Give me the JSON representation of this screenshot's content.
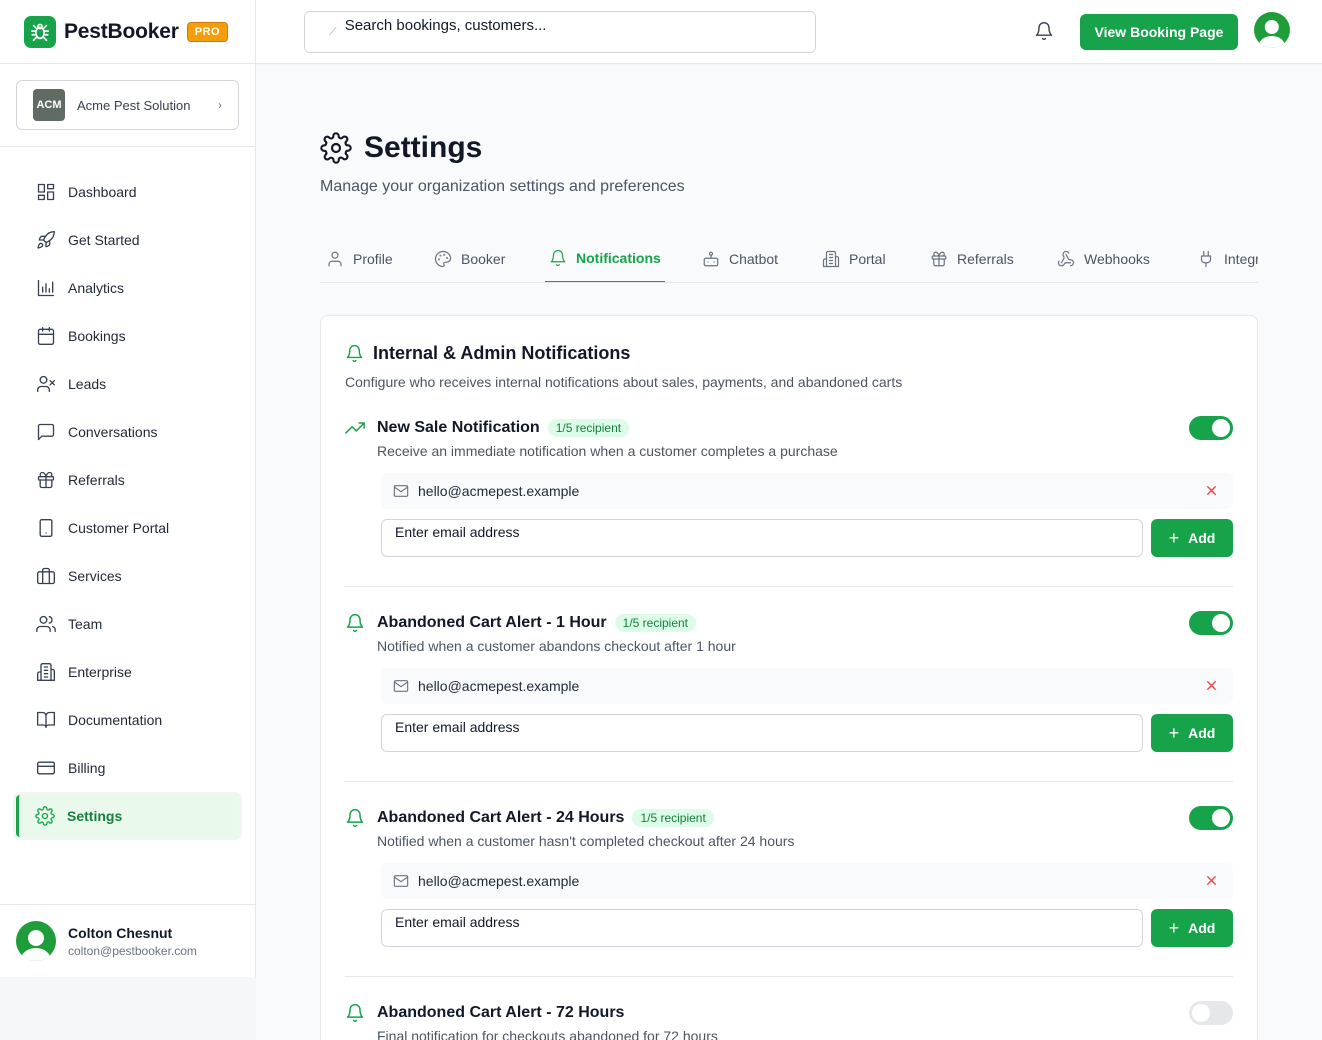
{
  "brand": {
    "name": "PestBooker",
    "badge": "PRO"
  },
  "org": {
    "name": "Acme Pest Solution",
    "logo_text": "ACM"
  },
  "sidebar": {
    "items": [
      {
        "label": "Dashboard",
        "icon": "dashboard-icon"
      },
      {
        "label": "Get Started",
        "icon": "rocket-icon"
      },
      {
        "label": "Analytics",
        "icon": "bar-chart-icon"
      },
      {
        "label": "Bookings",
        "icon": "calendar-icon"
      },
      {
        "label": "Leads",
        "icon": "user-x-icon"
      },
      {
        "label": "Conversations",
        "icon": "message-icon"
      },
      {
        "label": "Referrals",
        "icon": "gift-icon"
      },
      {
        "label": "Customer Portal",
        "icon": "tablet-icon"
      },
      {
        "label": "Services",
        "icon": "briefcase-icon"
      },
      {
        "label": "Team",
        "icon": "users-icon"
      },
      {
        "label": "Enterprise",
        "icon": "building-icon"
      },
      {
        "label": "Documentation",
        "icon": "book-icon"
      },
      {
        "label": "Billing",
        "icon": "credit-card-icon"
      },
      {
        "label": "Settings",
        "icon": "gear-icon",
        "active": true
      }
    ]
  },
  "user": {
    "name": "Colton Chesnut",
    "email": "colton@pestbooker.com"
  },
  "topbar": {
    "search_value": "Search bookings, customers...",
    "view_button": "View Booking Page"
  },
  "page": {
    "title": "Settings",
    "subtitle": "Manage your organization settings and preferences"
  },
  "tabs": [
    {
      "label": "Profile",
      "icon": "user-icon"
    },
    {
      "label": "Booker",
      "icon": "palette-icon"
    },
    {
      "label": "Notifications",
      "icon": "bell-icon",
      "active": true
    },
    {
      "label": "Chatbot",
      "icon": "bot-icon"
    },
    {
      "label": "Portal",
      "icon": "building-icon"
    },
    {
      "label": "Referrals",
      "icon": "gift-icon"
    },
    {
      "label": "Webhooks",
      "icon": "webhook-icon"
    },
    {
      "label": "Integr",
      "icon": "plug-icon"
    }
  ],
  "card": {
    "title": "Internal & Admin Notifications",
    "description": "Configure who receives internal notifications about sales, payments, and abandoned carts",
    "notifications": [
      {
        "title": "New Sale Notification",
        "badge": "1/5 recipient",
        "description": "Receive an immediate notification when a customer completes a purchase",
        "recipient": "hello@acmepest.example",
        "input_value": "Enter email address",
        "add_label": "Add",
        "enabled": true,
        "icon": "trending-up-icon"
      },
      {
        "title": "Abandoned Cart Alert - 1 Hour",
        "badge": "1/5 recipient",
        "description": "Notified when a customer abandons checkout after 1 hour",
        "recipient": "hello@acmepest.example",
        "input_value": "Enter email address",
        "add_label": "Add",
        "enabled": true,
        "icon": "bell-icon"
      },
      {
        "title": "Abandoned Cart Alert - 24 Hours",
        "badge": "1/5 recipient",
        "description": "Notified when a customer hasn't completed checkout after 24 hours",
        "recipient": "hello@acmepest.example",
        "input_value": "Enter email address",
        "add_label": "Add",
        "enabled": true,
        "icon": "bell-icon"
      },
      {
        "title": "Abandoned Cart Alert - 72 Hours",
        "description": "Final notification for checkouts abandoned for 72 hours",
        "enabled": false,
        "icon": "bell-icon"
      }
    ]
  },
  "colors": {
    "accent": "#16a34a",
    "badge_bg": "#dcfce7",
    "pro": "#f59e0b",
    "remove": "#ef4444"
  }
}
